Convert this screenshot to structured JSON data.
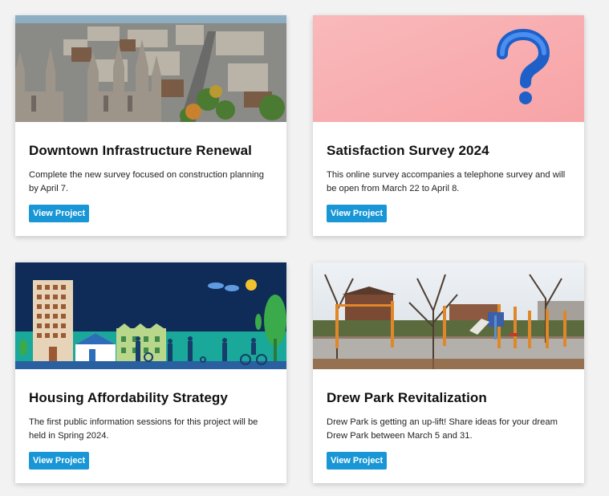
{
  "colors": {
    "button_bg": "#1996d6",
    "page_bg": "#f2f2f2",
    "card_bg": "#ffffff"
  },
  "projects": [
    {
      "title": "Downtown Infrastructure Renewal",
      "description": "Complete the new survey focused on construction planning by April 7.",
      "button_label": "View Project",
      "image": "aerial-downtown-photo"
    },
    {
      "title": "Satisfaction Survey 2024",
      "description": "This online survey accompanies a telephone survey and will be open from March 22 to April 8.",
      "button_label": "View Project",
      "image": "question-mark-photo"
    },
    {
      "title": "Housing Affordability Strategy",
      "description": "The first public information sessions for this project will be held in Spring 2024.",
      "button_label": "View Project",
      "image": "housing-illustration"
    },
    {
      "title": "Drew Park Revitalization",
      "description": "Drew Park is getting an up-lift! Share ideas for your dream Drew Park between March 5 and 31.",
      "button_label": "View Project",
      "image": "park-playground-photo"
    }
  ]
}
